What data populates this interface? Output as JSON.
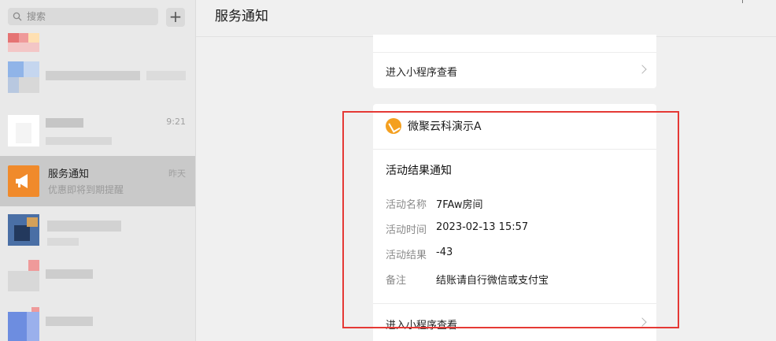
{
  "sidebar": {
    "search_placeholder": "搜索",
    "add_label": "+",
    "chats": [
      {
        "name": "",
        "preview": "",
        "time": ""
      },
      {
        "name": "",
        "preview": "",
        "time": "9:21"
      },
      {
        "name": "服务通知",
        "preview": "优惠即将到期提醒",
        "time": "昨天"
      },
      {
        "name": "",
        "preview": "",
        "time": ""
      },
      {
        "name": "",
        "preview": "",
        "time": ""
      }
    ]
  },
  "header": {
    "title": "服务通知"
  },
  "top_card": {
    "link_label": "进入小程序查看"
  },
  "notice": {
    "app_name": "微聚云科演示A",
    "title": "活动结果通知",
    "fields": [
      {
        "label": "活动名称",
        "value": "7FAw房间"
      },
      {
        "label": "活动时间",
        "value": "2023-02-13 15:57"
      },
      {
        "label": "活动结果",
        "value": "-43"
      },
      {
        "label": "备注",
        "value": "结账请自行微信或支付宝"
      }
    ],
    "link_label": "进入小程序查看"
  },
  "colors": {
    "highlight": "#e53935",
    "service_avatar": "#f08a2b"
  }
}
